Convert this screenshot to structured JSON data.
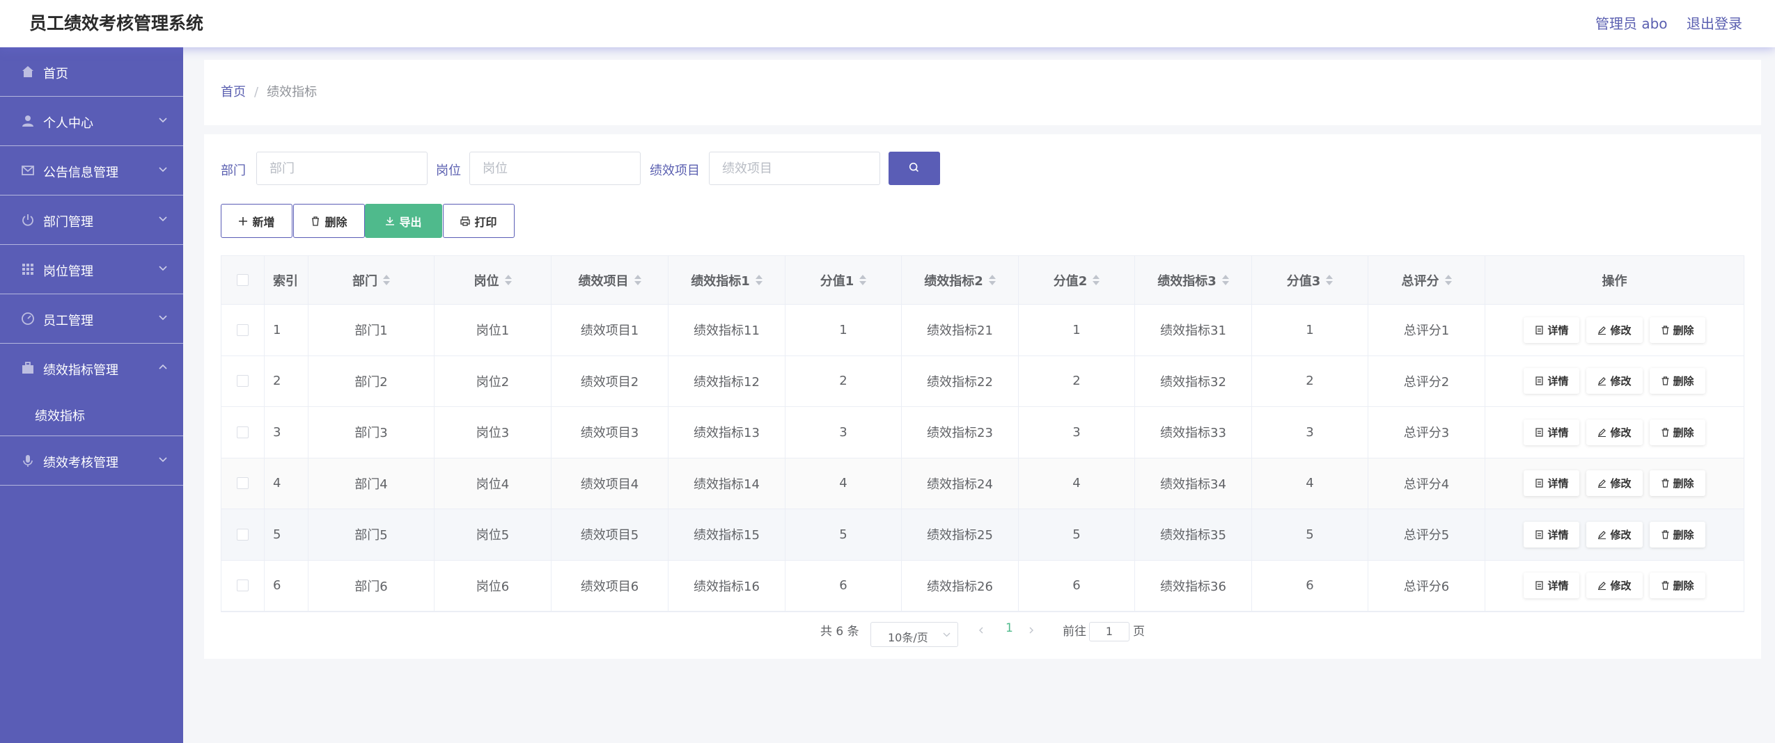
{
  "app": {
    "title": "员工绩效考核管理系统",
    "admin_label": "管理员 abo",
    "logout_label": "退出登录"
  },
  "sidebar": {
    "items": [
      {
        "label": "首页",
        "icon": "home-icon"
      },
      {
        "label": "个人中心",
        "icon": "user-icon"
      },
      {
        "label": "公告信息管理",
        "icon": "mail-icon"
      },
      {
        "label": "部门管理",
        "icon": "power-icon"
      },
      {
        "label": "岗位管理",
        "icon": "grid-icon"
      },
      {
        "label": "员工管理",
        "icon": "gauge-icon"
      },
      {
        "label": "绩效指标管理",
        "icon": "briefcase-icon"
      },
      {
        "label": "绩效考核管理",
        "icon": "mic-icon"
      }
    ],
    "submenu": {
      "label": "绩效指标"
    }
  },
  "breadcrumb": {
    "home": "首页",
    "separator": "/",
    "current": "绩效指标"
  },
  "filters": {
    "dept_label": "部门",
    "dept_placeholder": "部门",
    "post_label": "岗位",
    "post_placeholder": "岗位",
    "project_label": "绩效项目",
    "project_placeholder": "绩效项目"
  },
  "toolbar": {
    "add": "新增",
    "delete": "删除",
    "export": "导出",
    "print": "打印"
  },
  "table": {
    "headers": [
      "索引",
      "部门",
      "岗位",
      "绩效项目",
      "绩效指标1",
      "分值1",
      "绩效指标2",
      "分值2",
      "绩效指标3",
      "分值3",
      "总评分",
      "操作"
    ],
    "rows": [
      [
        "1",
        "部门1",
        "岗位1",
        "绩效项目1",
        "绩效指标11",
        "1",
        "绩效指标21",
        "1",
        "绩效指标31",
        "1",
        "总评分1"
      ],
      [
        "2",
        "部门2",
        "岗位2",
        "绩效项目2",
        "绩效指标12",
        "2",
        "绩效指标22",
        "2",
        "绩效指标32",
        "2",
        "总评分2"
      ],
      [
        "3",
        "部门3",
        "岗位3",
        "绩效项目3",
        "绩效指标13",
        "3",
        "绩效指标23",
        "3",
        "绩效指标33",
        "3",
        "总评分3"
      ],
      [
        "4",
        "部门4",
        "岗位4",
        "绩效项目4",
        "绩效指标14",
        "4",
        "绩效指标24",
        "4",
        "绩效指标34",
        "4",
        "总评分4"
      ],
      [
        "5",
        "部门5",
        "岗位5",
        "绩效项目5",
        "绩效指标15",
        "5",
        "绩效指标25",
        "5",
        "绩效指标35",
        "5",
        "总评分5"
      ],
      [
        "6",
        "部门6",
        "岗位6",
        "绩效项目6",
        "绩效指标16",
        "6",
        "绩效指标26",
        "6",
        "绩效指标36",
        "6",
        "总评分6"
      ]
    ],
    "actions": {
      "detail": "详情",
      "edit": "修改",
      "delete": "删除"
    }
  },
  "pagination": {
    "total": "共 6 条",
    "page_size": "10条/页",
    "current_page": "1",
    "goto_prefix": "前往",
    "goto_value": "1",
    "goto_suffix": "页"
  },
  "colors": {
    "primary": "#5a5db6",
    "export": "#4fba8c",
    "active_page": "#4fba8c"
  }
}
